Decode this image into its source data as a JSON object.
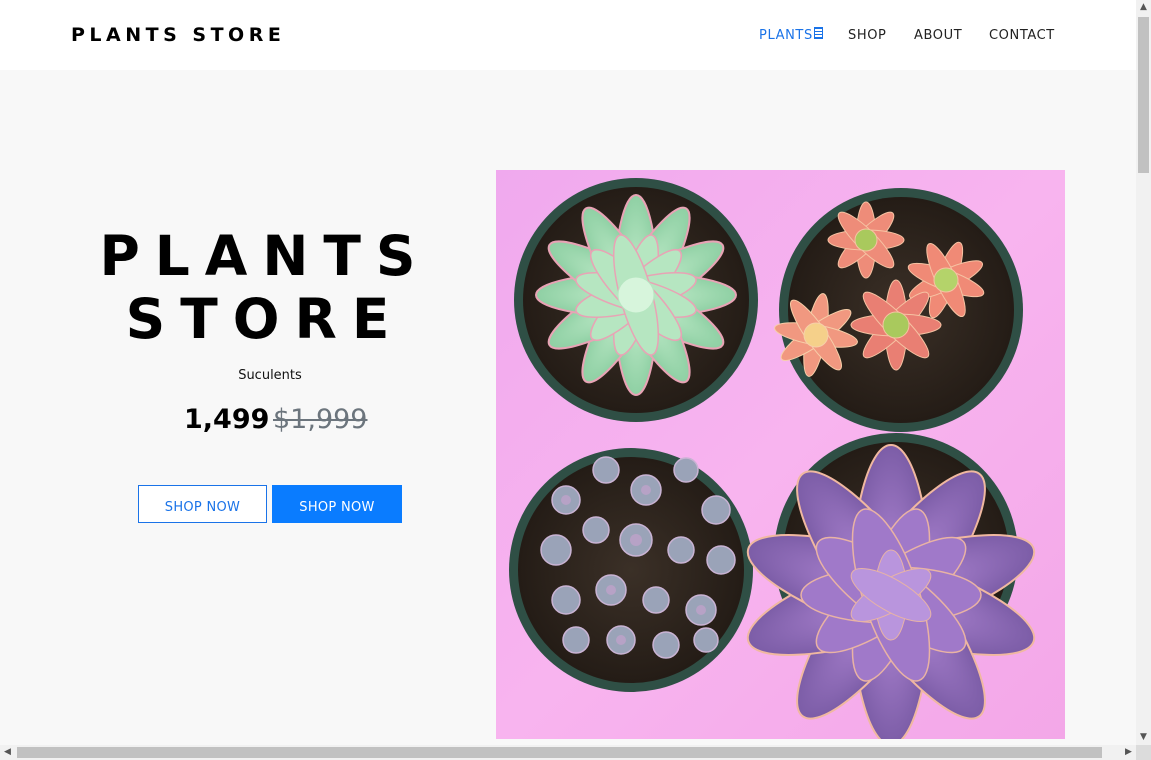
{
  "navbar": {
    "brand": "PLANTS STORE",
    "items": [
      {
        "label": "PLANTS",
        "active": true
      },
      {
        "label": "SHOP",
        "active": false
      },
      {
        "label": "ABOUT",
        "active": false
      },
      {
        "label": "CONTACT",
        "active": false
      }
    ],
    "accent_color": "#1a73e8"
  },
  "hero": {
    "title_line1": "PLANTS",
    "title_line2": "STORE",
    "subtitle": "Suculents",
    "price": "1,499",
    "old_price": "$1,999",
    "buttons": [
      {
        "label": "SHOP NOW",
        "style": "outline"
      },
      {
        "label": "SHOP NOW",
        "style": "solid"
      }
    ],
    "button_color": "#0a7cff",
    "image_alt": "four potted succulents"
  },
  "scrollbars": {
    "vertical_up": "▲",
    "vertical_down": "▼",
    "horizontal_left": "◀",
    "horizontal_right": "▶"
  }
}
